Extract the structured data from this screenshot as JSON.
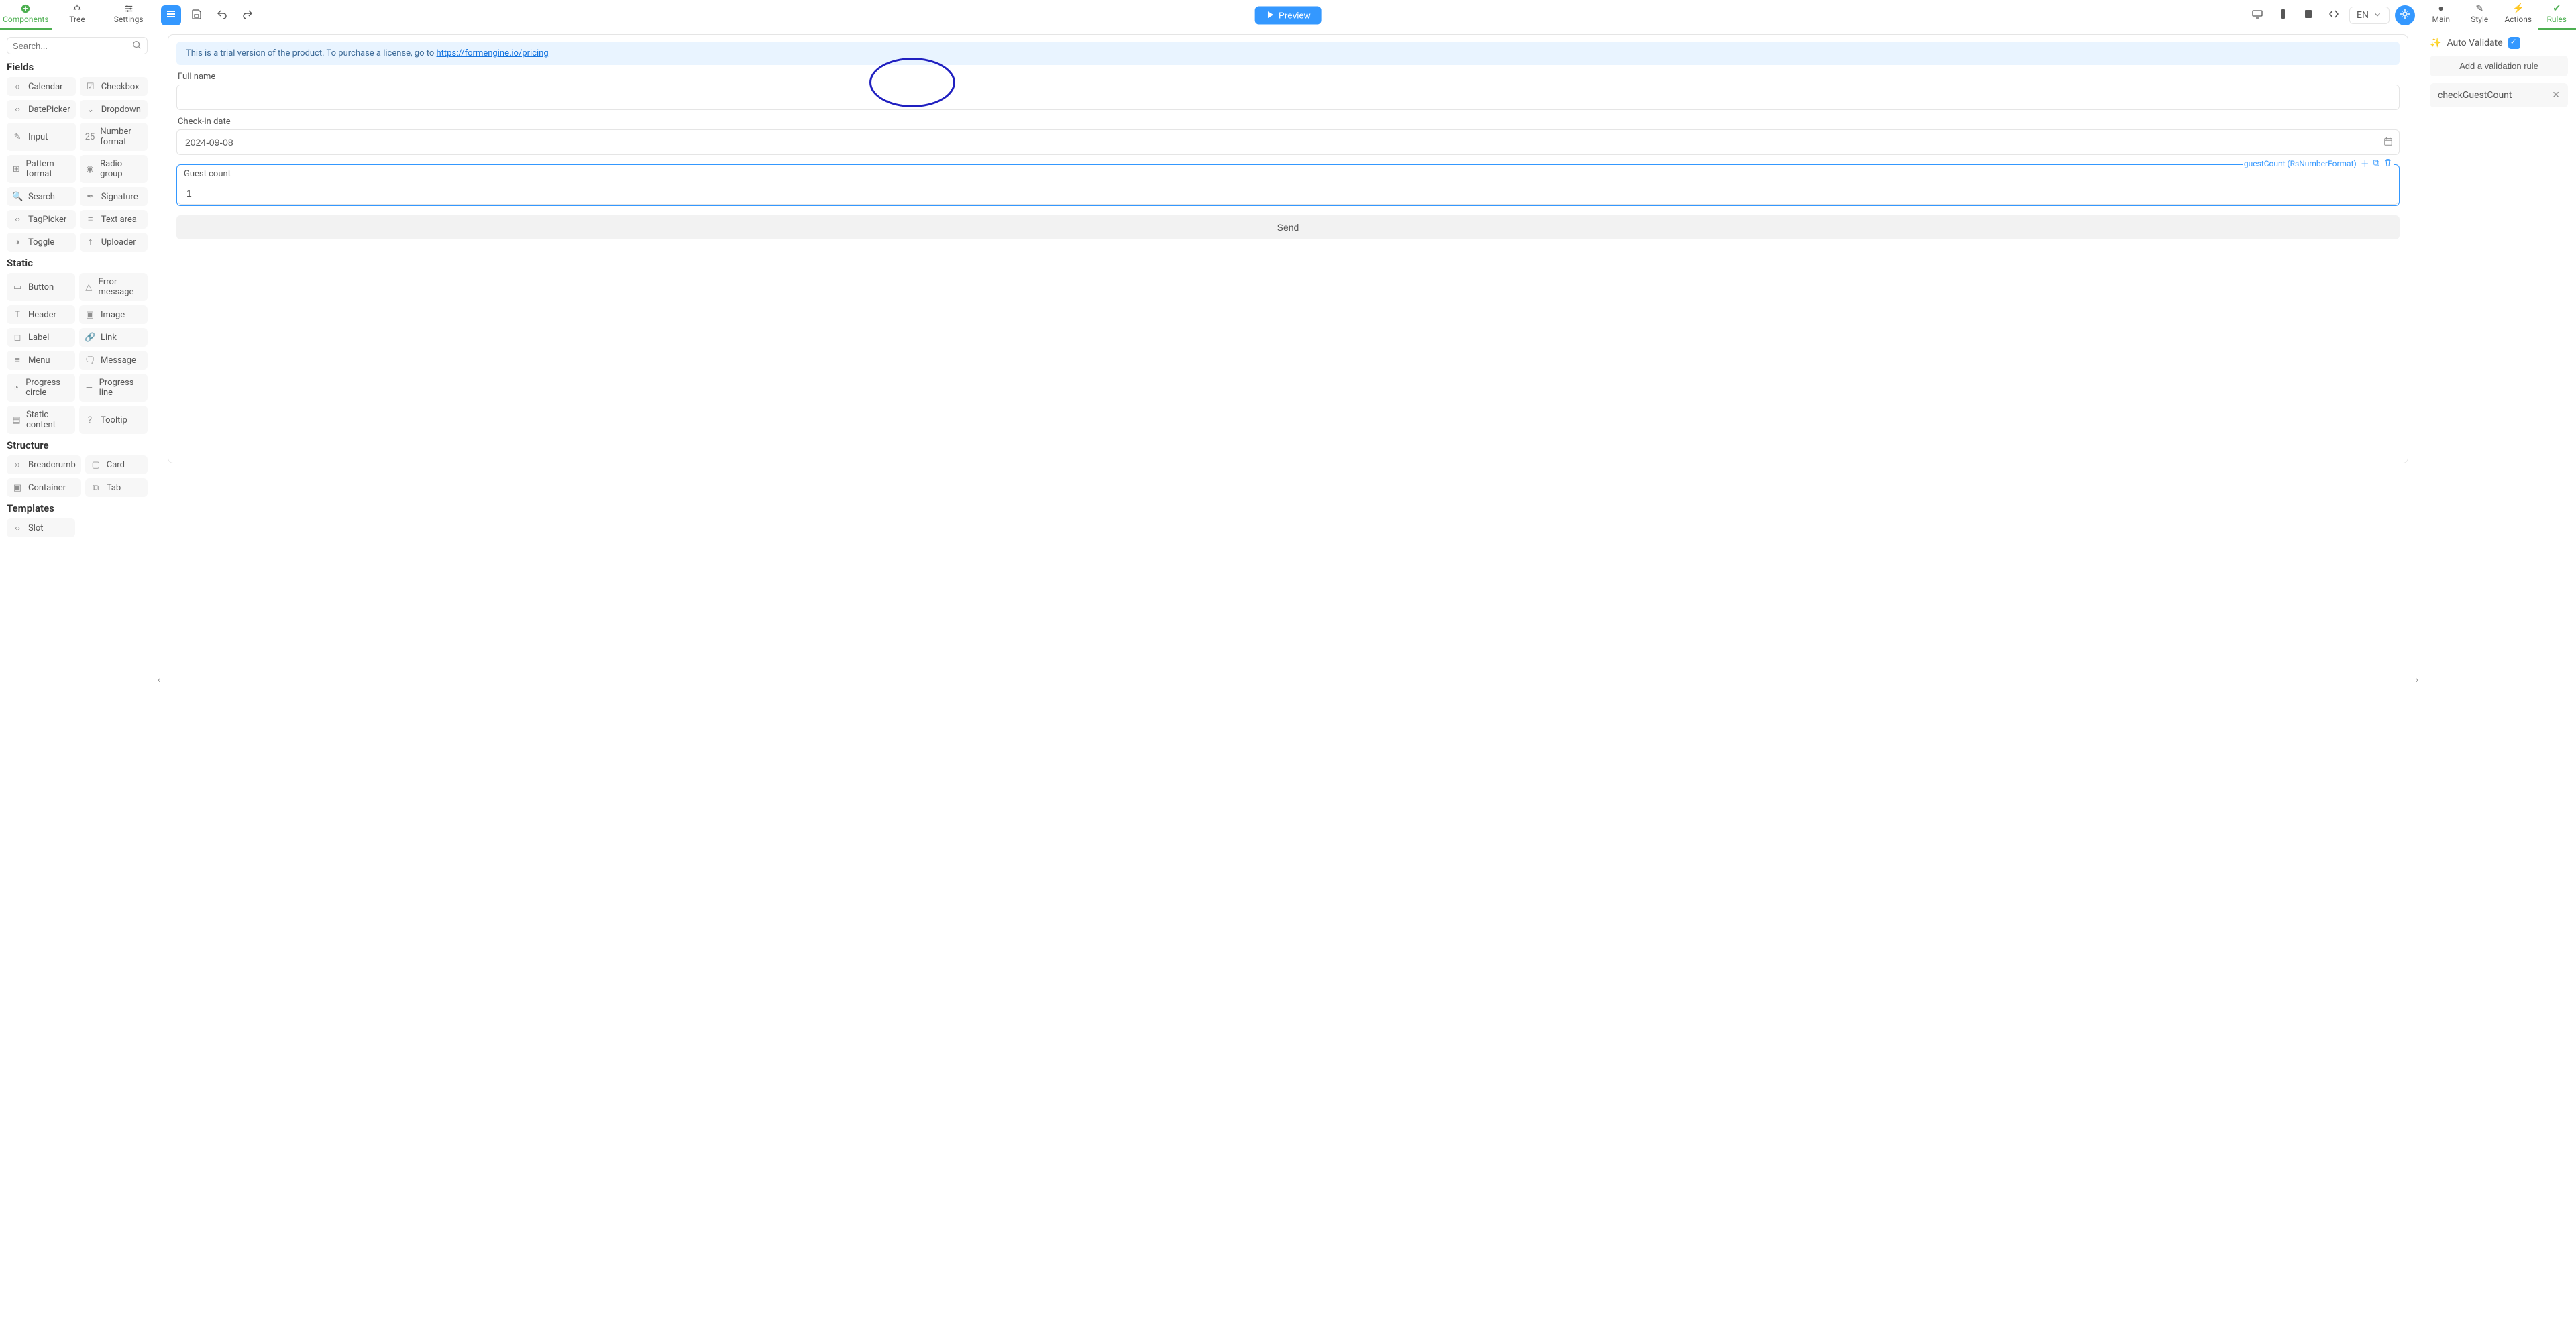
{
  "top_left_tabs": [
    {
      "label": "Components",
      "active": true
    },
    {
      "label": "Tree",
      "active": false
    },
    {
      "label": "Settings",
      "active": false
    }
  ],
  "top_right_tabs": [
    {
      "label": "Main",
      "active": false
    },
    {
      "label": "Style",
      "active": false
    },
    {
      "label": "Actions",
      "active": false
    },
    {
      "label": "Rules",
      "active": true
    }
  ],
  "preview_label": "Preview",
  "language": "EN",
  "search_placeholder": "Search...",
  "palette": {
    "groups": [
      {
        "title": "Fields",
        "items": [
          {
            "label": "Calendar",
            "icon": "‹›"
          },
          {
            "label": "Checkbox",
            "icon": "☑"
          },
          {
            "label": "DatePicker",
            "icon": "‹›"
          },
          {
            "label": "Dropdown",
            "icon": "⌄"
          },
          {
            "label": "Input",
            "icon": "✎"
          },
          {
            "label": "Number format",
            "icon": "25"
          },
          {
            "label": "Pattern format",
            "icon": "⊞"
          },
          {
            "label": "Radio group",
            "icon": "◉"
          },
          {
            "label": "Search",
            "icon": "🔍"
          },
          {
            "label": "Signature",
            "icon": "✒"
          },
          {
            "label": "TagPicker",
            "icon": "‹›"
          },
          {
            "label": "Text area",
            "icon": "≡"
          },
          {
            "label": "Toggle",
            "icon": "◑"
          },
          {
            "label": "Uploader",
            "icon": "⤒"
          }
        ]
      },
      {
        "title": "Static",
        "items": [
          {
            "label": "Button",
            "icon": "▭"
          },
          {
            "label": "Error message",
            "icon": "△"
          },
          {
            "label": "Header",
            "icon": "T"
          },
          {
            "label": "Image",
            "icon": "▣"
          },
          {
            "label": "Label",
            "icon": "◻"
          },
          {
            "label": "Link",
            "icon": "🔗"
          },
          {
            "label": "Menu",
            "icon": "≡"
          },
          {
            "label": "Message",
            "icon": "🗨"
          },
          {
            "label": "Progress circle",
            "icon": "◔"
          },
          {
            "label": "Progress line",
            "icon": "—"
          },
          {
            "label": "Static content",
            "icon": "▤"
          },
          {
            "label": "Tooltip",
            "icon": "?"
          }
        ]
      },
      {
        "title": "Structure",
        "items": [
          {
            "label": "Breadcrumb",
            "icon": "››"
          },
          {
            "label": "Card",
            "icon": "▢"
          },
          {
            "label": "Container",
            "icon": "▣"
          },
          {
            "label": "Tab",
            "icon": "⧉"
          }
        ]
      },
      {
        "title": "Templates",
        "items": [
          {
            "label": "Slot",
            "icon": "‹›"
          }
        ]
      }
    ]
  },
  "canvas": {
    "trial_text": "This is a trial version of the product. To purchase a license, go to ",
    "trial_link": "https://formengine.io/pricing",
    "full_name_label": "Full name",
    "full_name_value": "",
    "checkin_label": "Check-in date",
    "checkin_value": "2024-09-08",
    "guest_label": "Guest count",
    "guest_value": "1",
    "selection_caption": "guestCount (RsNumberFormat)",
    "send_label": "Send"
  },
  "rules_panel": {
    "auto_validate_label": "Auto Validate",
    "auto_validate_checked": true,
    "add_rule_label": "Add a validation rule",
    "rules": [
      {
        "name": "checkGuestCount"
      }
    ]
  }
}
